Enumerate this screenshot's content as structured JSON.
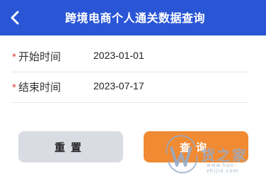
{
  "header": {
    "title": "跨境电商个人通关数据查询",
    "background_color": "#2a56d6",
    "back_icon": "chevron-left-icon"
  },
  "form": {
    "required_marker": "*",
    "start": {
      "label": "开始时间",
      "value": "2023-01-01"
    },
    "end": {
      "label": "结束时间",
      "value": "2023-07-17"
    }
  },
  "buttons": {
    "reset_label": "重置",
    "query_label": "查询",
    "reset_color": "#d9dce3",
    "query_color": "#f08a33"
  },
  "watermark": {
    "brand": "货之家",
    "url": "www.huo-zhijia.com"
  }
}
